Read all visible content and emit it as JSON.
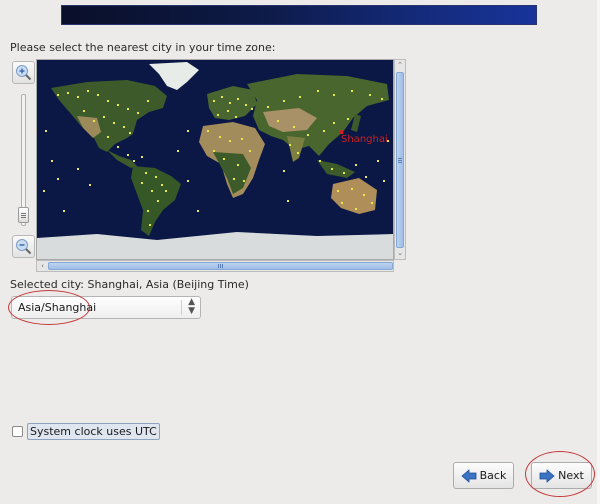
{
  "header": {
    "prompt": "Please select the nearest city in your time zone:"
  },
  "map": {
    "highlight_city": "Shanghai",
    "highlight_color": "#cc2222",
    "ocean_color": "#0b1745",
    "city_dot_color": "#e8e84a",
    "zoom_in_icon": "zoom-in-icon",
    "zoom_out_icon": "zoom-out-icon"
  },
  "selection": {
    "label": "Selected city: Shanghai, Asia (Beijing Time)",
    "timezone_value": "Asia/Shanghai"
  },
  "options": {
    "utc_label": "System clock uses UTC",
    "utc_checked": false
  },
  "footer": {
    "back_label": "Back",
    "next_label": "Next"
  },
  "annotation_color": "#c43a3a"
}
